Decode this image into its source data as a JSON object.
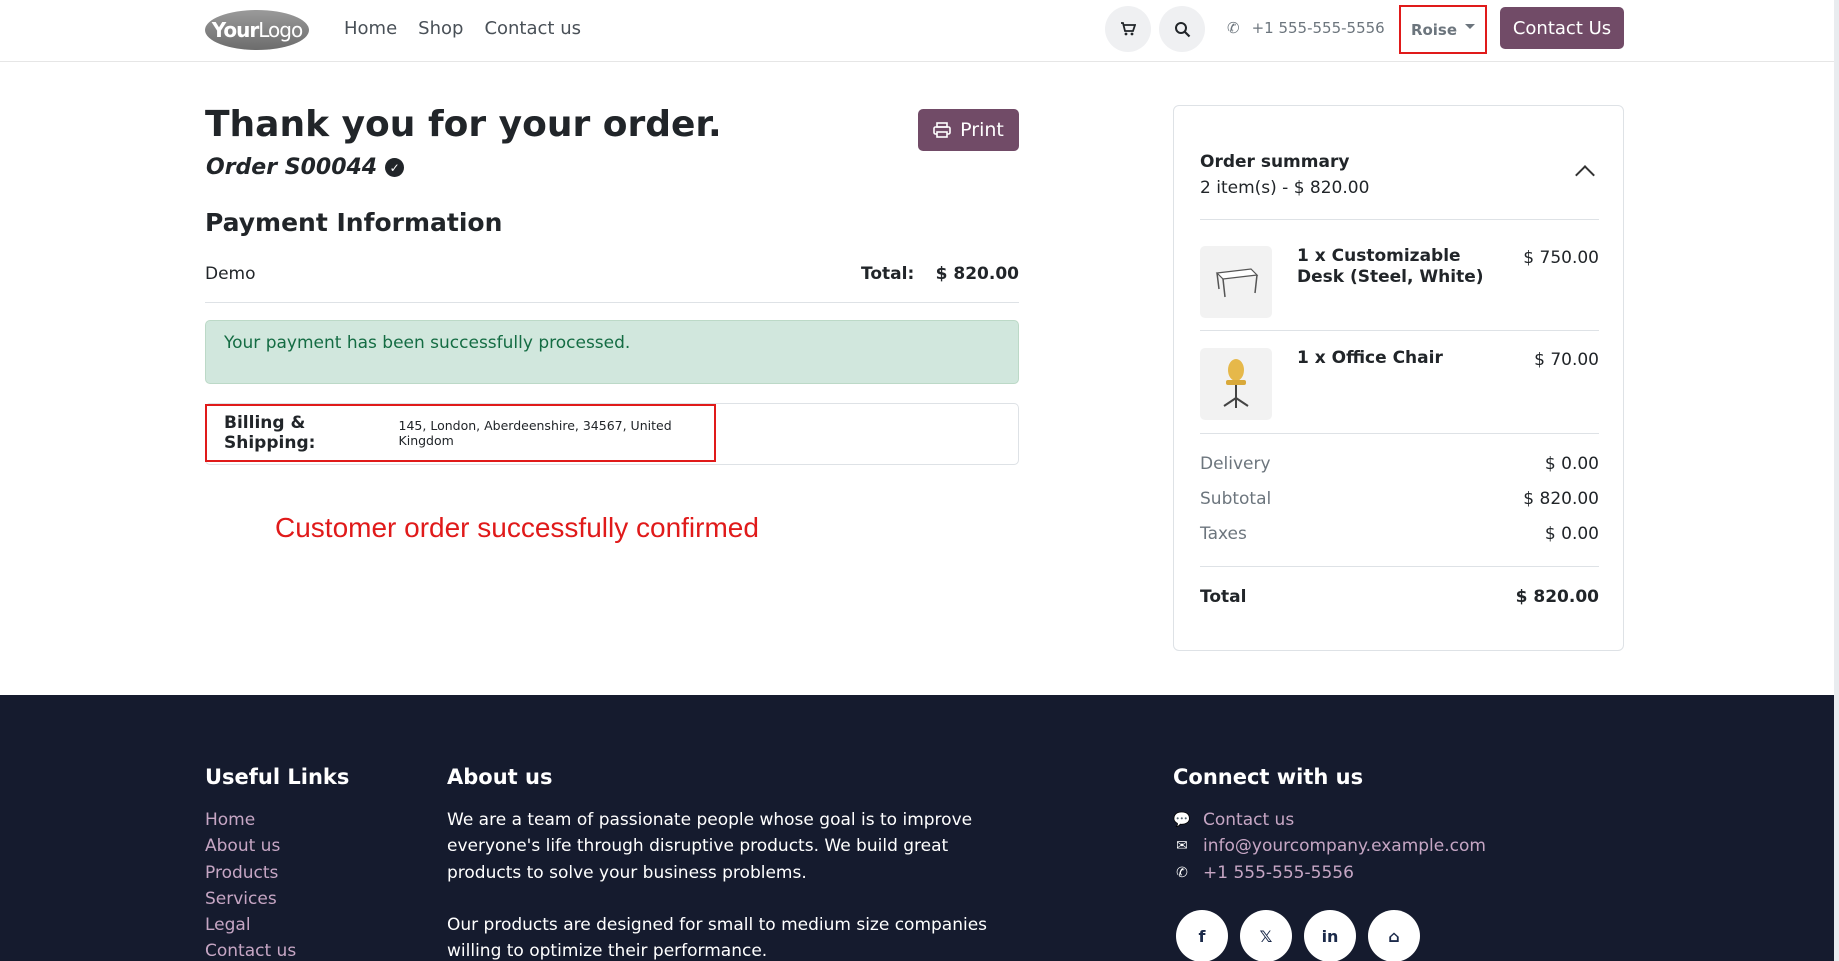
{
  "header": {
    "logo": {
      "bold": "Your",
      "light": "Logo"
    },
    "nav": [
      "Home",
      "Shop",
      "Contact us"
    ],
    "phone": "+1 555-555-5556",
    "language": "Roise",
    "contact_button": "Contact Us"
  },
  "order": {
    "title": "Thank you for your order.",
    "order_id": "Order S00044",
    "print_label": "Print",
    "payment_title": "Payment Information",
    "payment_method": "Demo",
    "total_label": "Total:",
    "total_value": "$ 820.00",
    "alert": "Your payment has been successfully processed.",
    "billing_label": "Billing & Shipping:",
    "billing_address": "145, London, Aberdeenshire, 34567, United Kingdom",
    "annotation": "Customer order successfully confirmed"
  },
  "summary": {
    "title": "Order summary",
    "count": "2 item(s) -  $ 820.00",
    "items": [
      {
        "name": "1 x Customizable Desk (Steel, White)",
        "price": "$ 750.00",
        "icon": "desk-icon"
      },
      {
        "name": "1 x Office Chair",
        "price": "$ 70.00",
        "icon": "chair-icon"
      }
    ],
    "delivery_label": "Delivery",
    "delivery_value": "$ 0.00",
    "subtotal_label": "Subtotal",
    "subtotal_value": "$ 820.00",
    "taxes_label": "Taxes",
    "taxes_value": "$ 0.00",
    "total_label": "Total",
    "total_value": "$ 820.00"
  },
  "footer": {
    "useful_title": "Useful Links",
    "links": [
      "Home",
      "About us",
      "Products",
      "Services",
      "Legal",
      "Contact us"
    ],
    "about_title": "About us",
    "about_p1": "We are a team of passionate people whose goal is to improve everyone's life through disruptive products. We build great products to solve your business problems.",
    "about_p2": "Our products are designed for small to medium size companies willing to optimize their performance.",
    "connect_title": "Connect with us",
    "contact_link": "Contact us",
    "email": "info@yourcompany.example.com",
    "phone": "+1 555-555-5556",
    "social": [
      "facebook-icon",
      "x-icon",
      "linkedin-icon",
      "home-icon"
    ]
  },
  "colors": {
    "brand": "#714b67",
    "footer_bg": "#151b2e",
    "alert_bg": "#d1e7dd",
    "highlight": "#e01a1a"
  }
}
